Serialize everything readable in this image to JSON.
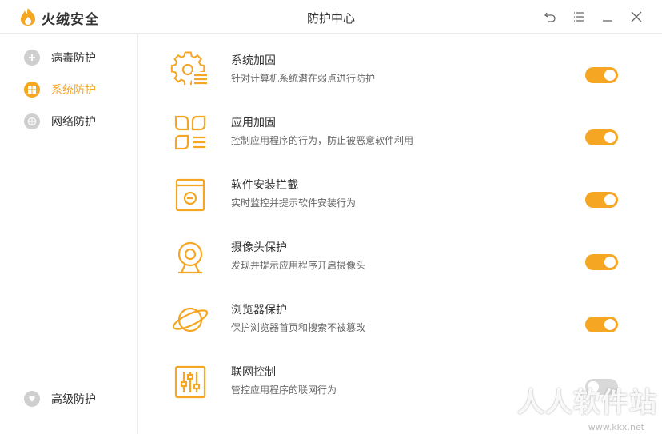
{
  "app": {
    "name": "火绒安全",
    "window_title": "防护中心"
  },
  "colors": {
    "accent": "#f5a623",
    "gray_icon": "#cfcfcf"
  },
  "sidebar": {
    "items": [
      {
        "label": "病毒防护",
        "icon": "plus-shield-icon",
        "active": false
      },
      {
        "label": "系统防护",
        "icon": "windows-icon",
        "active": true
      },
      {
        "label": "网络防护",
        "icon": "globe-icon",
        "active": false
      }
    ],
    "bottom_item": {
      "label": "高级防护",
      "icon": "diamond-icon"
    }
  },
  "features": [
    {
      "title": "系统加固",
      "desc": "针对计算机系统潜在弱点进行防护",
      "icon": "gear-list-icon",
      "enabled": true
    },
    {
      "title": "应用加固",
      "desc": "控制应用程序的行为，防止被恶意软件利用",
      "icon": "app-grid-icon",
      "enabled": true
    },
    {
      "title": "软件安装拦截",
      "desc": "实时监控并提示软件安装行为",
      "icon": "install-box-icon",
      "enabled": true
    },
    {
      "title": "摄像头保护",
      "desc": "发现并提示应用程序开启摄像头",
      "icon": "webcam-icon",
      "enabled": true
    },
    {
      "title": "浏览器保护",
      "desc": "保护浏览器首页和搜索不被篡改",
      "icon": "planet-icon",
      "enabled": true
    },
    {
      "title": "联网控制",
      "desc": "管控应用程序的联网行为",
      "icon": "sliders-icon",
      "enabled": false
    }
  ],
  "watermark": {
    "text": "人人软件站",
    "url": "www.kkx.net"
  }
}
